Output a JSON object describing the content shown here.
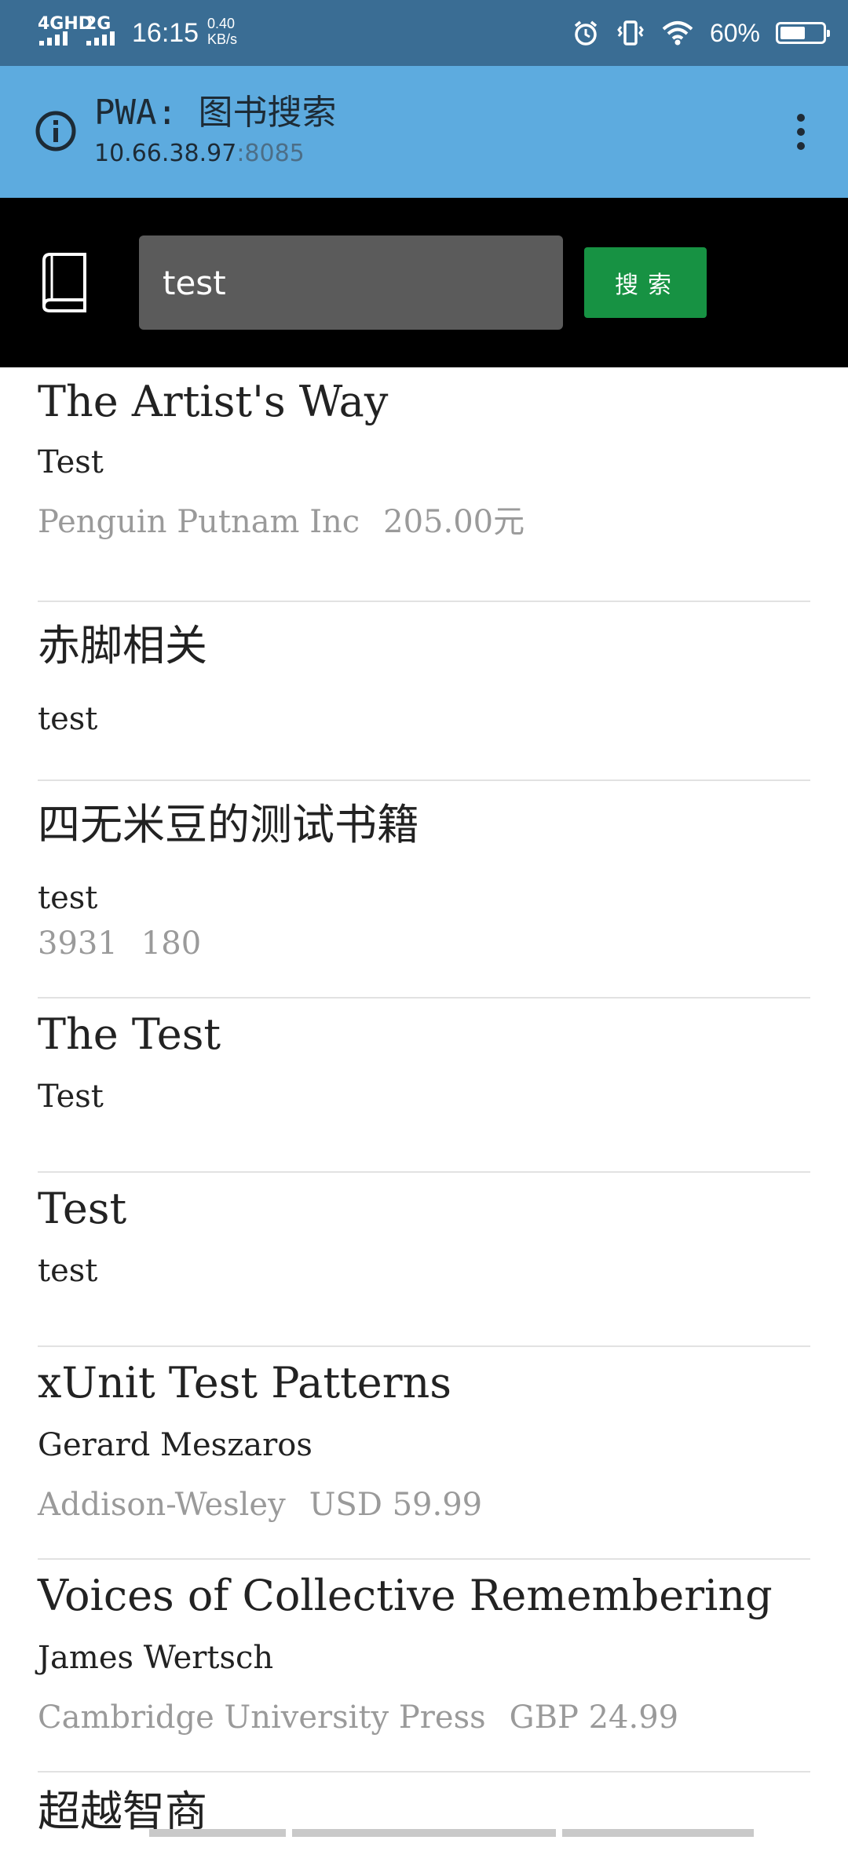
{
  "status_bar": {
    "network_1": "4GHD",
    "network_2": "2G",
    "time": "16:15",
    "speed_value": "0.40",
    "speed_unit": "KB/s",
    "battery_percent": "60%",
    "battery_level": 0.6
  },
  "browser": {
    "title": "PWA: 图书搜索",
    "url_host": "10.66.38.97",
    "url_port": ":8085"
  },
  "search": {
    "value": "test",
    "button_label": "搜索"
  },
  "results": [
    {
      "title": "The Artist's Way",
      "author": "Test",
      "publisher": "Penguin Putnam Inc",
      "price": "205.00元"
    },
    {
      "title": "赤脚相关",
      "author": "test",
      "publisher": "",
      "price": ""
    },
    {
      "title": "四无米豆的测试书籍",
      "author": "test",
      "publisher": "3931",
      "price": "180"
    },
    {
      "title": "The Test",
      "author": "Test",
      "publisher": "",
      "price": ""
    },
    {
      "title": "Test",
      "author": "test",
      "publisher": "",
      "price": ""
    },
    {
      "title": "xUnit Test Patterns",
      "author": "Gerard Meszaros",
      "publisher": "Addison-Wesley",
      "price": "USD 59.99"
    },
    {
      "title": "Voices of Collective Remembering",
      "author": "James Wertsch",
      "publisher": "Cambridge University Press",
      "price": "GBP 24.99"
    },
    {
      "title": "超越智商",
      "author": "",
      "publisher": "",
      "price": ""
    }
  ]
}
